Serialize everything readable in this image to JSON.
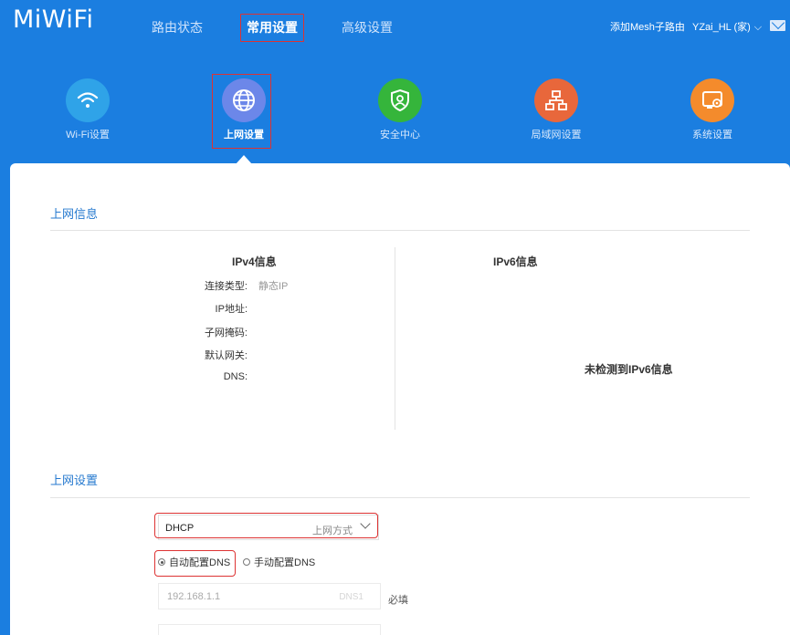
{
  "brand": {
    "logo": "MiWiFi"
  },
  "topnav": {
    "items": [
      {
        "label": "路由状态"
      },
      {
        "label": "常用设置"
      },
      {
        "label": "高级设置"
      }
    ],
    "mesh_label": "添加Mesh子路由",
    "user_label": "YZai_HL (家)"
  },
  "categories": [
    {
      "label": "Wi-Fi设置",
      "icon": "wifi-icon",
      "color": "#2fa3e8"
    },
    {
      "label": "上网设置",
      "icon": "globe-icon",
      "color": "#6c87e9"
    },
    {
      "label": "安全中心",
      "icon": "shield-user-icon",
      "color": "#35b53b"
    },
    {
      "label": "局域网设置",
      "icon": "lan-network-icon",
      "color": "#e8673b"
    },
    {
      "label": "系统设置",
      "icon": "system-settings-icon",
      "color": "#f48b2c"
    }
  ],
  "net_info": {
    "title": "上网信息",
    "ipv4": {
      "title": "IPv4信息",
      "rows": [
        {
          "label": "连接类型:",
          "value": "静态IP"
        },
        {
          "label": "IP地址:",
          "value": ""
        },
        {
          "label": "子网掩码:",
          "value": ""
        },
        {
          "label": "默认网关:",
          "value": ""
        },
        {
          "label": "DNS:",
          "value": ""
        }
      ]
    },
    "ipv6": {
      "title": "IPv6信息",
      "empty_msg": "未检测到IPv6信息"
    }
  },
  "net_settings": {
    "title": "上网设置",
    "mode_value": "DHCP",
    "mode_placeholder": "上网方式",
    "dns_options": [
      {
        "label": "自动配置DNS",
        "selected": true
      },
      {
        "label": "手动配置DNS",
        "selected": false
      }
    ],
    "dns1_value": "192.168.1.1",
    "dns1_tag": "DNS1",
    "required_label": "必填"
  }
}
